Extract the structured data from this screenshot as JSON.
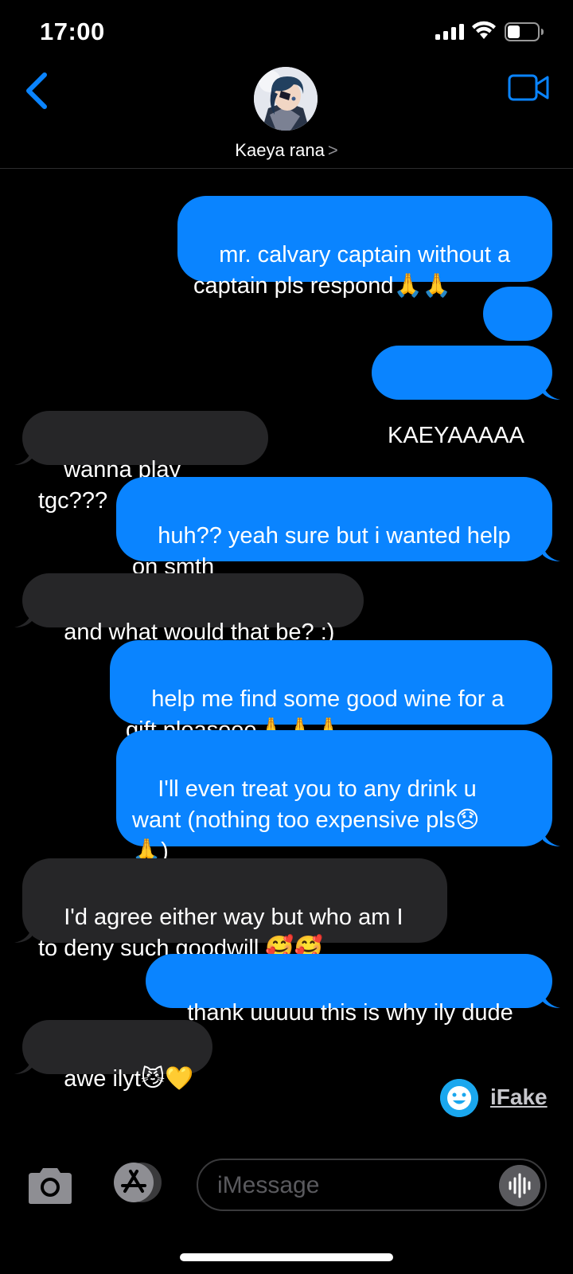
{
  "status_bar": {
    "time": "17:00"
  },
  "header": {
    "contact_name": "Kaeya rana",
    "chevron": ">"
  },
  "messages": [
    {
      "from": "me",
      "text": "mr. calvary captain without a\ncaptain pls respond🙏🙏"
    },
    {
      "from": "me",
      "text": "???"
    },
    {
      "from": "me",
      "text": "KAEYAAAAA"
    },
    {
      "from": "them",
      "text": "wanna play tgc???"
    },
    {
      "from": "me",
      "text": "huh?? yeah sure but i wanted help\non smth"
    },
    {
      "from": "them",
      "text": "and what would that be? :)"
    },
    {
      "from": "me",
      "text": "help me find some good wine for a\ngift pleaseee🙏🙏🙏"
    },
    {
      "from": "me",
      "text": "I'll even treat you to any drink u\nwant (nothing too expensive pls😞\n🙏)"
    },
    {
      "from": "them",
      "text": "I'd agree either way but who am I\nto deny such goodwill 🥰🥰"
    },
    {
      "from": "me",
      "text": "thank uuuuu this is why ily dude"
    },
    {
      "from": "them",
      "text": "awe ilyt😼💛"
    }
  ],
  "watermark": {
    "label": "iFake"
  },
  "input": {
    "placeholder": "iMessage"
  },
  "colors": {
    "sent_bubble": "#0a84ff",
    "received_bubble": "#262628",
    "accent": "#0a84ff"
  },
  "icons": [
    "signal-icon",
    "wifi-icon",
    "battery-icon",
    "back-chevron-icon",
    "video-camera-icon",
    "camera-icon",
    "appstore-icon",
    "audio-waveform-icon"
  ]
}
